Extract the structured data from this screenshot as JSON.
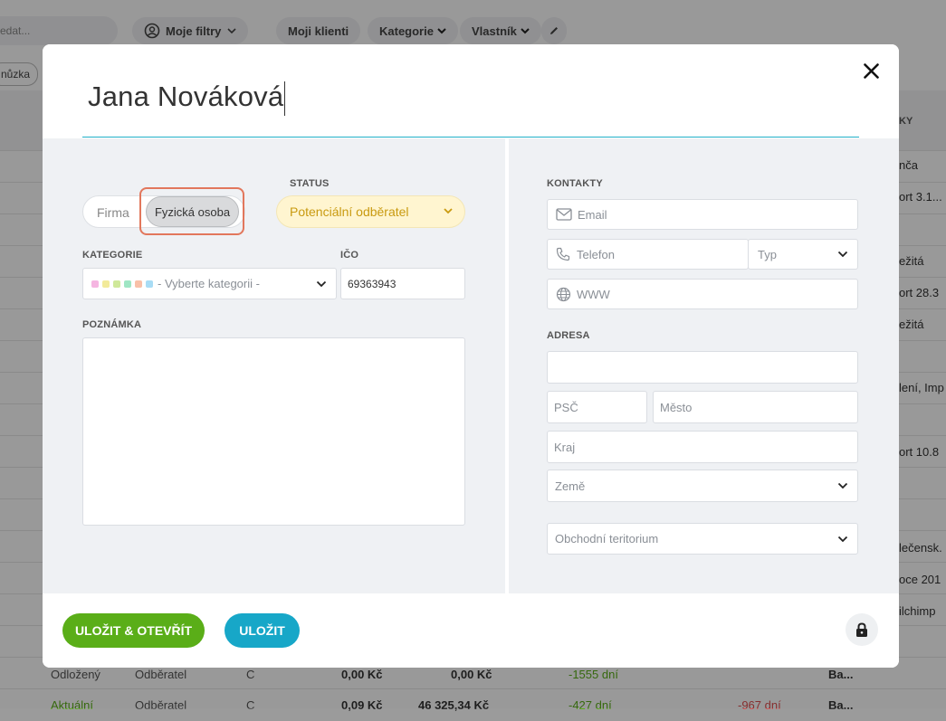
{
  "background": {
    "search_placeholder": "edat...",
    "my_filters": "Moje filtry",
    "my_clients": "Moji klienti",
    "category": "Kategorie",
    "owner": "Vlastník",
    "tag": "nůzka",
    "column_header": "KY",
    "right_cells": [
      "nča",
      "ort 3.1...",
      "ežitá",
      "ort 28.3",
      "ežitá",
      "lení, Imp",
      "ort 10.8",
      "lečensk.",
      "oce 201",
      "ilchimp"
    ],
    "row1": {
      "status": "Odložený",
      "type": "Odběratel",
      "class": "C",
      "amount1": "0,00 Kč",
      "amount2": "0,00 Kč",
      "days": "-1555 dní",
      "owner": "Ba..."
    },
    "row2": {
      "status": "Aktuální",
      "type": "Odběratel",
      "class": "C",
      "amount1": "0,09 Kč",
      "amount2": "46 325,34 Kč",
      "days": "-427 dní",
      "days2": "-967 dní",
      "owner": "Ba..."
    }
  },
  "modal": {
    "name": "Jana Nováková",
    "type_toggle": {
      "option_company": "Firma",
      "option_person": "Fyzická osoba",
      "selected": "Fyzická osoba"
    },
    "status": {
      "label": "STATUS",
      "value": "Potenciální odběratel"
    },
    "category": {
      "label": "KATEGORIE",
      "placeholder": "- Vyberte kategorii -",
      "dot_colors": [
        "#f5b5e1",
        "#f2ea9a",
        "#cfe89a",
        "#9fe6c4",
        "#f8c0a8",
        "#a8dcf5"
      ]
    },
    "ico": {
      "label": "IČO",
      "value": "69363943"
    },
    "note": {
      "label": "POZNÁMKA",
      "value": ""
    },
    "contacts": {
      "label": "KONTAKTY",
      "email_placeholder": "Email",
      "phone_placeholder": "Telefon",
      "phone_type_placeholder": "Typ",
      "web_placeholder": "WWW"
    },
    "address": {
      "label": "ADRESA",
      "street_value": "",
      "zip_placeholder": "PSČ",
      "city_placeholder": "Město",
      "region_placeholder": "Kraj",
      "country_placeholder": "Země",
      "territory_placeholder": "Obchodní teritorium"
    },
    "buttons": {
      "save_open": "ULOŽIT & OTEVŘÍT",
      "save": "ULOŽIT"
    }
  },
  "colors": {
    "accent_teal": "#17a7c8",
    "accent_green": "#5aae18",
    "status_yellow": "#c99a10",
    "highlight": "#e2775c"
  }
}
